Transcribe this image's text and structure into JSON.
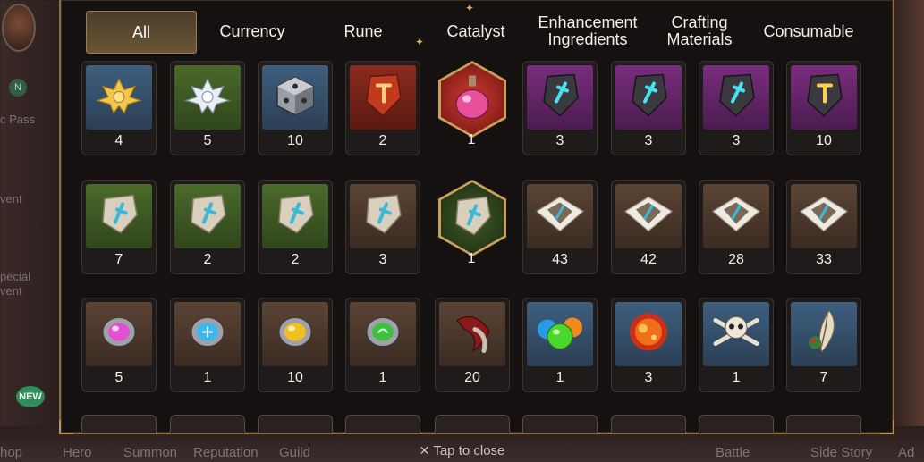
{
  "tabs": [
    {
      "label": "All",
      "active": true
    },
    {
      "label": "Currency",
      "active": false
    },
    {
      "label": "Rune",
      "active": false
    },
    {
      "label": "Catalyst",
      "active": false
    },
    {
      "label": "Enhancement Ingredients",
      "active": false
    },
    {
      "label": "Crafting Materials",
      "active": false
    },
    {
      "label": "Consumable",
      "active": false
    }
  ],
  "items": [
    [
      {
        "icon": "gold-flower-icon",
        "count": "4",
        "bg": "blue"
      },
      {
        "icon": "silver-flower-icon",
        "count": "5",
        "bg": "green"
      },
      {
        "icon": "steel-cube-icon",
        "count": "10",
        "bg": "blue"
      },
      {
        "icon": "red-rune-stone-icon",
        "count": "2",
        "bg": "red"
      },
      {
        "icon": "pink-potion-icon",
        "count": "1",
        "bg": "hex"
      },
      {
        "icon": "cyan-rune-stone-icon",
        "count": "3",
        "bg": "purple"
      },
      {
        "icon": "cyan-rune-stone-icon",
        "count": "3",
        "bg": "purple"
      },
      {
        "icon": "cyan-rune-stone-icon",
        "count": "3",
        "bg": "purple"
      },
      {
        "icon": "gold-rune-stone-icon",
        "count": "10",
        "bg": "purple"
      }
    ],
    [
      {
        "icon": "pale-rune-stone-icon",
        "count": "7",
        "bg": "green"
      },
      {
        "icon": "pale-rune-stone-icon",
        "count": "2",
        "bg": "green"
      },
      {
        "icon": "pale-rune-stone-icon",
        "count": "2",
        "bg": "green"
      },
      {
        "icon": "pale-rune-stone-icon",
        "count": "3",
        "bg": "brown"
      },
      {
        "icon": "pale-rune-stone-icon",
        "count": "1",
        "bg": "hex-green"
      },
      {
        "icon": "rune-fragment-icon",
        "count": "43",
        "bg": "brown"
      },
      {
        "icon": "rune-fragment-icon",
        "count": "42",
        "bg": "brown"
      },
      {
        "icon": "rune-fragment-icon",
        "count": "28",
        "bg": "brown"
      },
      {
        "icon": "rune-fragment-icon",
        "count": "33",
        "bg": "brown"
      }
    ],
    [
      {
        "icon": "pink-gem-icon",
        "count": "5",
        "bg": "brown"
      },
      {
        "icon": "blue-gem-icon",
        "count": "1",
        "bg": "brown"
      },
      {
        "icon": "yellow-gem-icon",
        "count": "10",
        "bg": "brown"
      },
      {
        "icon": "green-gem-icon",
        "count": "1",
        "bg": "brown"
      },
      {
        "icon": "claw-icon",
        "count": "20",
        "bg": "brown"
      },
      {
        "icon": "slime-orbs-icon",
        "count": "1",
        "bg": "blue"
      },
      {
        "icon": "lava-orb-icon",
        "count": "3",
        "bg": "blue"
      },
      {
        "icon": "skull-crossbones-icon",
        "count": "1",
        "bg": "blue"
      },
      {
        "icon": "feather-icon",
        "count": "7",
        "bg": "blue"
      }
    ]
  ],
  "footer": {
    "close_label": "Tap to close"
  },
  "background": {
    "bottom_nav": [
      "hop",
      "Hero",
      "Summon",
      "Reputation",
      "Guild",
      "Battle",
      "Side Story",
      "Ad"
    ],
    "left_labels": [
      "c Pass",
      "vent",
      "pecial",
      "vent"
    ],
    "new_badge": "NEW",
    "left_badge": "N"
  },
  "colors": {
    "panel_border": "#8a6f46",
    "active_tab": "#6a5636",
    "count_text": "#f4f1ea"
  }
}
